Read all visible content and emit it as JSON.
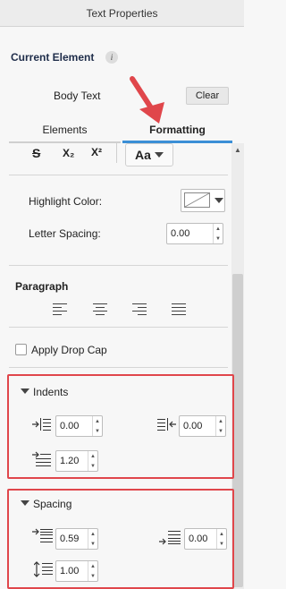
{
  "window": {
    "title": "Text Properties"
  },
  "current_element": {
    "heading": "Current Element",
    "info_icon": "i",
    "element_name": "Body Text",
    "clear_label": "Clear"
  },
  "tabs": [
    {
      "label": "Elements"
    },
    {
      "label": "Formatting"
    }
  ],
  "formatting_toolbar": {
    "subscript": "X₂",
    "superscript": "X²"
  },
  "highlight": {
    "label": "Highlight Color:"
  },
  "letter_spacing": {
    "label": "Letter Spacing:",
    "value": "0.00"
  },
  "paragraph": {
    "heading": "Paragraph"
  },
  "drop_cap": {
    "label": "Apply Drop Cap"
  },
  "indents": {
    "heading": "Indents",
    "left": "0.00",
    "right": "0.00",
    "first_line": "1.20"
  },
  "spacing": {
    "heading": "Spacing",
    "before": "0.59",
    "after": "0.00",
    "line": "1.00"
  },
  "colors": {
    "accent": "#3b8fd6",
    "annotation": "#e0464b"
  }
}
